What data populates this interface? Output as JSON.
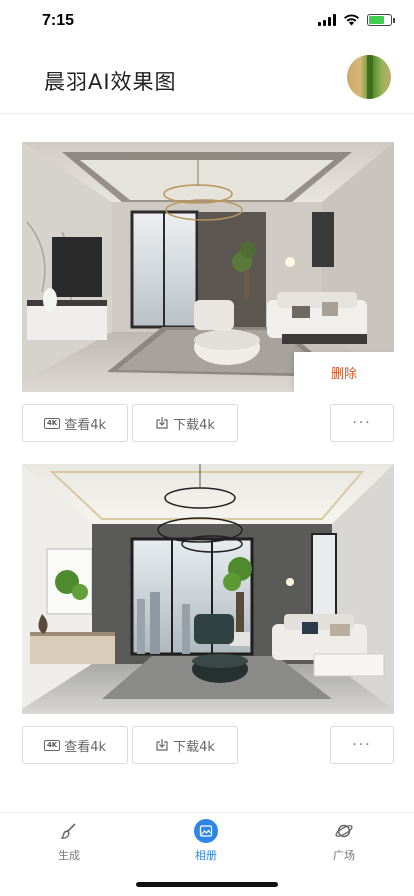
{
  "status_bar": {
    "time": "7:15"
  },
  "header": {
    "title": "晨羽AI效果图"
  },
  "cards": [
    {
      "view_label": "查看4k",
      "download_label": "下载4k",
      "more_label": "···",
      "delete_label": "删除"
    },
    {
      "view_label": "查看4k",
      "download_label": "下载4k",
      "more_label": "···"
    }
  ],
  "tabs": [
    {
      "label": "生成",
      "icon": "brush-icon"
    },
    {
      "label": "相册",
      "icon": "image-icon",
      "active": true
    },
    {
      "label": "广场",
      "icon": "planet-icon"
    }
  ],
  "badge_4k": "4K",
  "colors": {
    "accent": "#2f86e6",
    "delete": "#d4572a"
  }
}
